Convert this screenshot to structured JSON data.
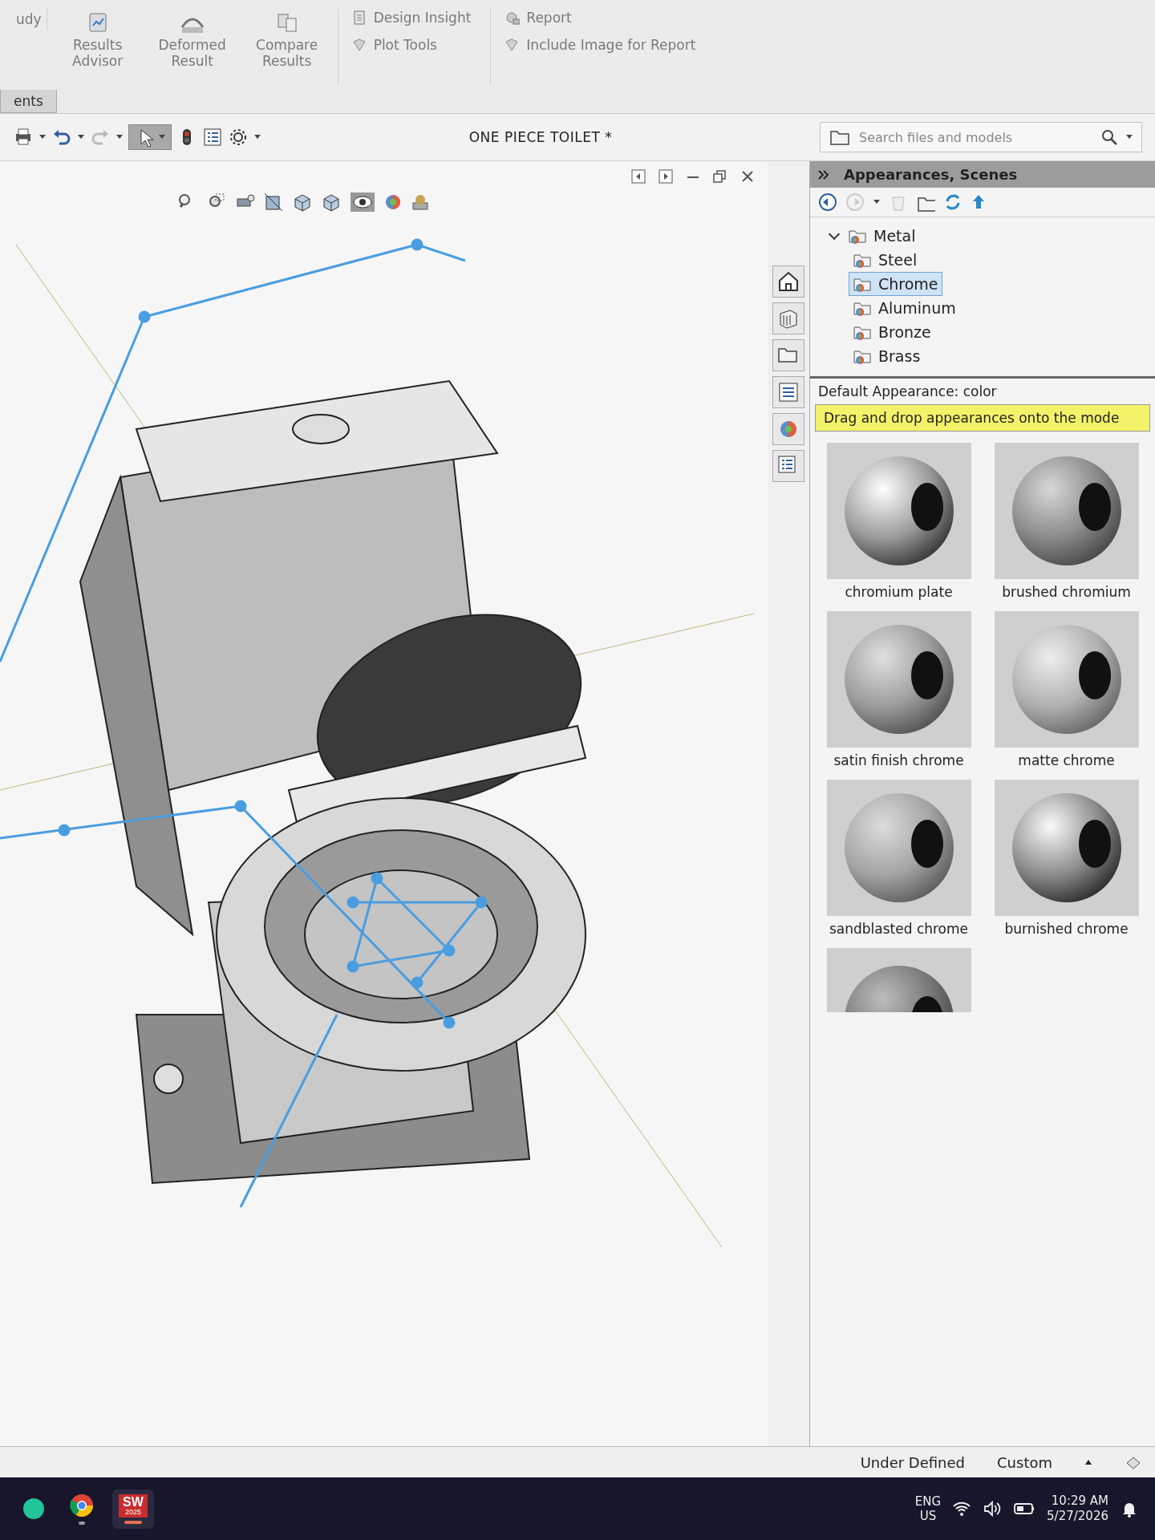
{
  "ribbon": {
    "groups": [
      {
        "kind": "cut",
        "label": "udy"
      },
      {
        "kind": "tool",
        "label": "Results Advisor"
      },
      {
        "kind": "tool",
        "label": "Deformed Result"
      },
      {
        "kind": "tool",
        "label": "Compare Results"
      },
      {
        "kind": "stack",
        "items": [
          "Design Insight",
          "Plot Tools"
        ]
      },
      {
        "kind": "stack",
        "items": [
          "Report",
          "Include Image for Report"
        ]
      }
    ],
    "tab": "ents"
  },
  "window": {
    "title": "ONE PIECE TOILET *"
  },
  "search": {
    "placeholder": "Search files and models"
  },
  "panel": {
    "title": "Appearances, Scenes",
    "tree": [
      {
        "label": "Metal",
        "expanded": true,
        "selected": false,
        "children": [
          {
            "label": "Steel",
            "selected": false
          },
          {
            "label": "Chrome",
            "selected": true
          },
          {
            "label": "Aluminum",
            "selected": false
          },
          {
            "label": "Bronze",
            "selected": false
          },
          {
            "label": "Brass",
            "selected": false
          }
        ]
      }
    ],
    "caption": "Default Appearance: color",
    "tip": "Drag and drop appearances onto the mode",
    "swatches": [
      {
        "kind": "glossy",
        "label": "chromium plate"
      },
      {
        "kind": "brushed",
        "label": "brushed chromium"
      },
      {
        "kind": "satin",
        "label": "satin finish chrome"
      },
      {
        "kind": "matte",
        "label": "matte chrome"
      },
      {
        "kind": "sandblasted",
        "label": "sandblasted chrome"
      },
      {
        "kind": "burnished",
        "label": "burnished chrome"
      },
      {
        "kind": "textured"
      }
    ]
  },
  "status_bar": {
    "state": "Under Defined",
    "units": "Custom"
  },
  "taskbar": {
    "apps": [
      {
        "kind": "generic",
        "running": false,
        "focused": false
      },
      {
        "kind": "browser",
        "running": true,
        "focused": false
      },
      {
        "kind": "solidworks",
        "running": true,
        "focused": true,
        "label": "SW",
        "sublabel": "2025"
      }
    ],
    "language": "ENG",
    "region": "US",
    "time": "10:29 AM",
    "date": "5/27/2026"
  }
}
